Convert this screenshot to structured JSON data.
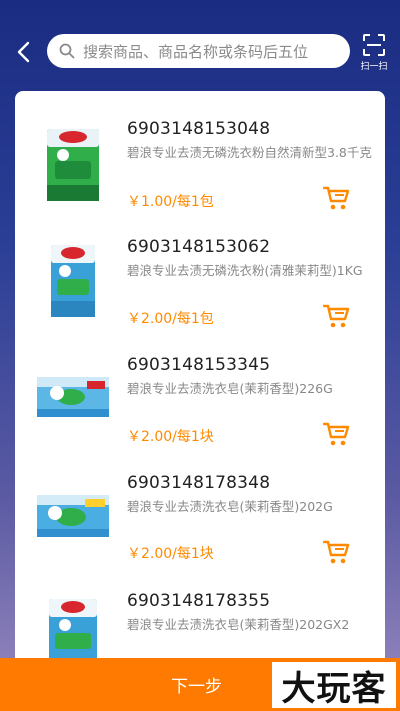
{
  "search": {
    "placeholder": "搜索商品、商品名称或条码后五位"
  },
  "scan": {
    "label": "扫一扫"
  },
  "products": [
    {
      "code": "6903148153048",
      "name": "碧浪专业去渍无磷洗衣粉自然清新型3.8千克",
      "price": "￥1.00/每1包",
      "thumb": "powder-bag"
    },
    {
      "code": "6903148153062",
      "name": "碧浪专业去渍无磷洗衣粉(清雅茉莉型)1KG",
      "price": "￥2.00/每1包",
      "thumb": "powder-bag"
    },
    {
      "code": "6903148153345",
      "name": "碧浪专业去渍洗衣皂(茉莉香型)226G",
      "price": "￥2.00/每1块",
      "thumb": "soap-bar"
    },
    {
      "code": "6903148178348",
      "name": "碧浪专业去渍洗衣皂(茉莉香型)202G",
      "price": "￥2.00/每1块",
      "thumb": "soap-bar"
    },
    {
      "code": "6903148178355",
      "name": "碧浪专业去渍洗衣皂(茉莉香型)202GX2",
      "price": "",
      "thumb": "powder-bag"
    }
  ],
  "next_button": {
    "label": "下一步"
  },
  "watermark": {
    "text": "大玩客"
  },
  "colors": {
    "accent": "#ff7a00",
    "price": "#ff8a00",
    "header": "#1a2c82"
  }
}
